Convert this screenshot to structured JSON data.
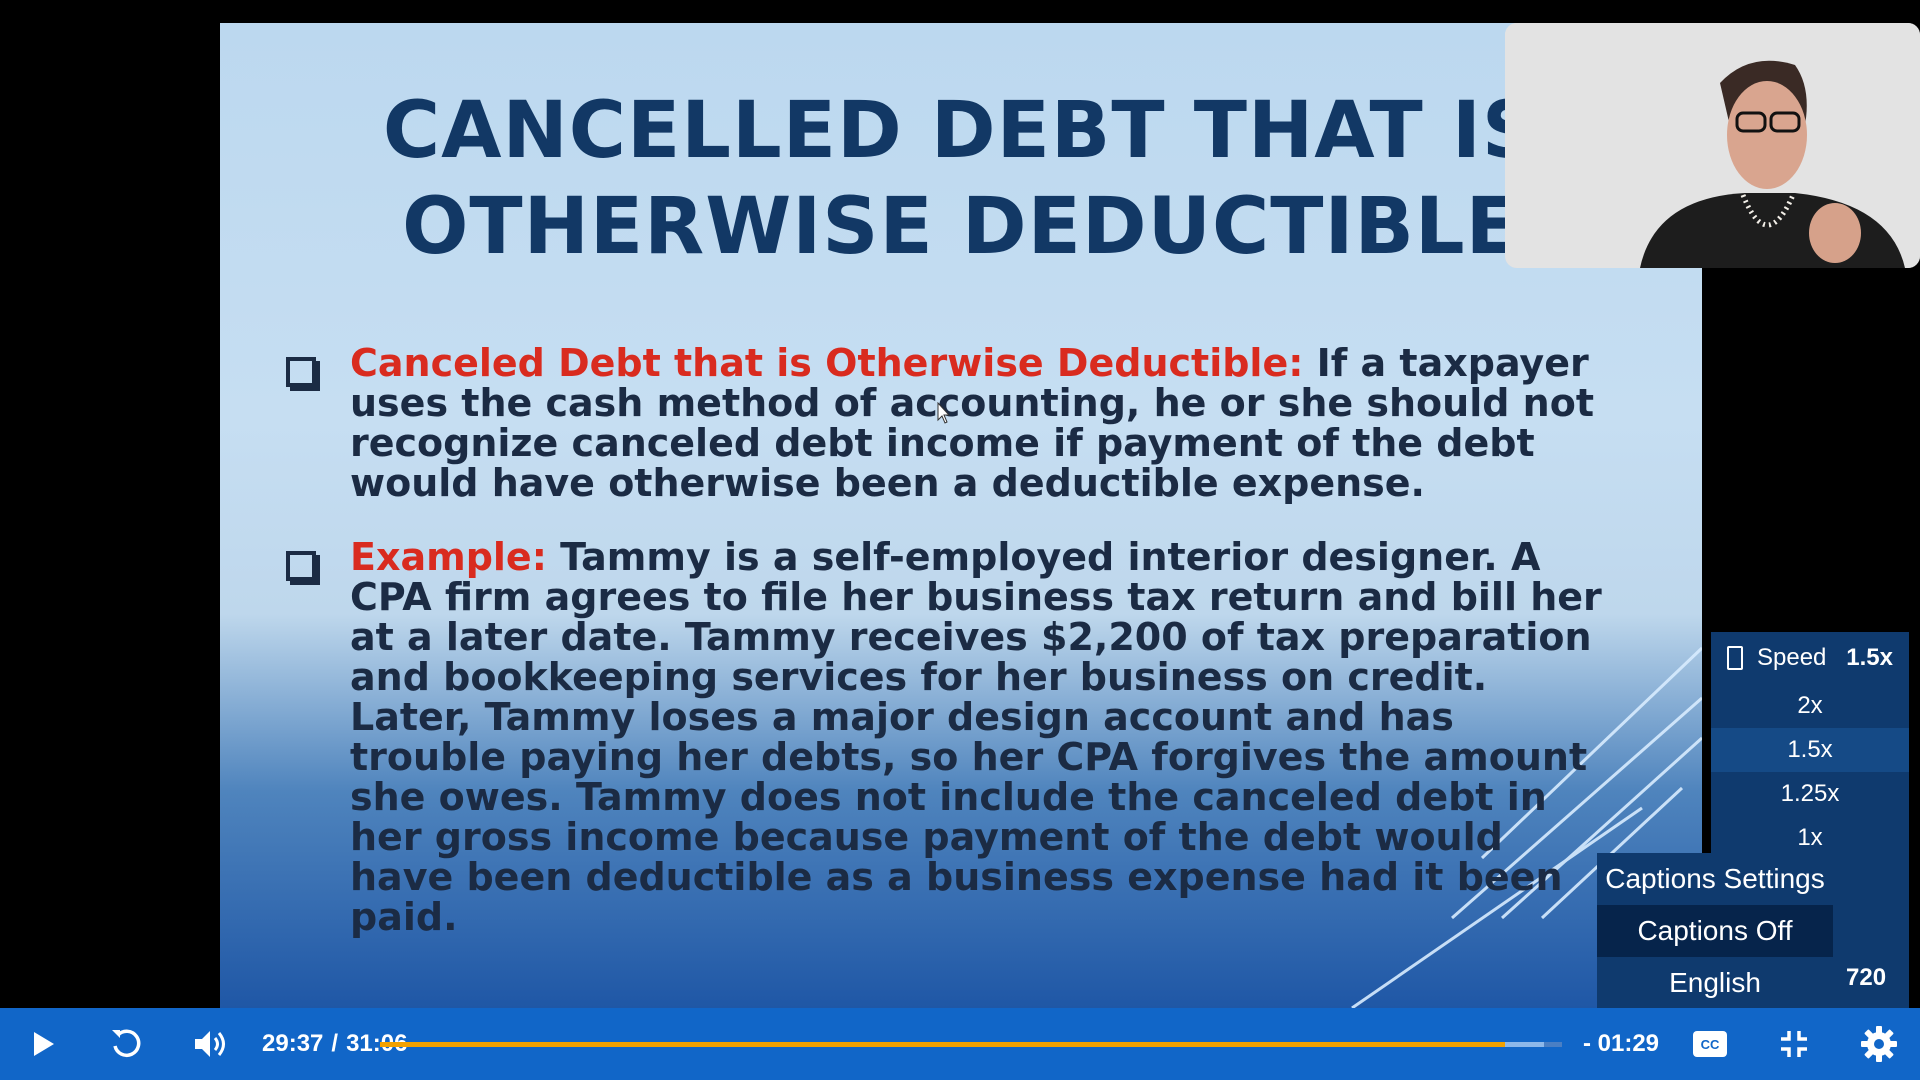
{
  "slide": {
    "title_line1": "CANCELLED DEBT THAT IS",
    "title_line2": "OTHERWISE DEDUCTIBLE",
    "bullets": [
      {
        "lead": "Canceled Debt that is Otherwise Deductible:",
        "text": " If a taxpayer uses the cash method of accounting, he or she should not recognize canceled debt income if payment of the debt would have otherwise been a deductible expense."
      },
      {
        "lead": "Example:",
        "text": " Tammy is a self-employed interior designer. A CPA firm agrees to file her business tax return and bill her at a later date. Tammy receives $2,200 of tax preparation and bookkeeping services for her business on credit. Later, Tammy loses a major design account and has trouble paying her debts, so her CPA forgives the amount she owes. Tammy does not include the canceled debt in her gross income because payment of the debt would have been deductible as a business expense had it been paid."
      }
    ]
  },
  "speed_menu": {
    "label": "Speed",
    "current": "1.5x",
    "options": [
      "2x",
      "1.5x",
      "1.25x",
      "1x"
    ],
    "selected": "1.5x"
  },
  "captions_menu": {
    "items": [
      "Captions Settings",
      "Captions Off",
      "English"
    ],
    "selected": "Captions Off"
  },
  "quality": "720",
  "controls": {
    "current_time": "29:37",
    "separator": "/",
    "duration": "31:06",
    "remaining": "- 01:29",
    "progress_fraction": 0.952,
    "buffered_fraction": 0.985,
    "icons": [
      "play-icon",
      "replay-icon",
      "volume-icon",
      "closed-captions-icon",
      "exit-fullscreen-icon",
      "settings-gear-icon"
    ]
  },
  "colors": {
    "controls_bar": "#1166c8",
    "progress_fill": "#f2a100",
    "menu_bg": "#0f3a6e",
    "title_text": "#123865",
    "bullet_lead": "#d92b1f"
  }
}
